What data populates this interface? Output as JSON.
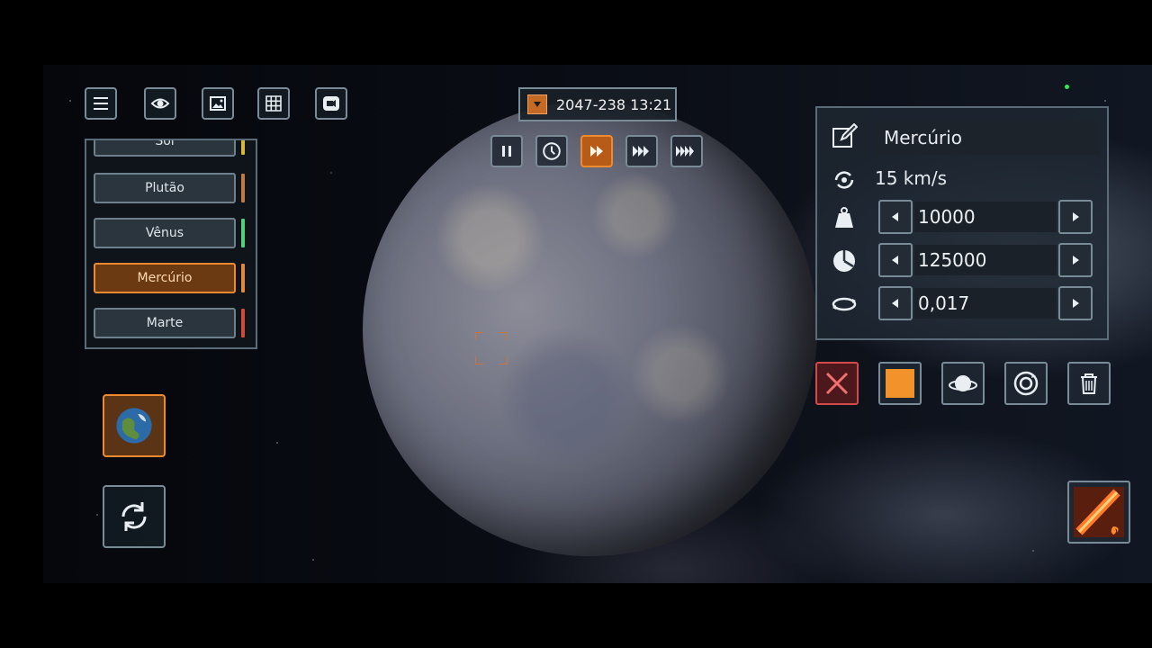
{
  "toolbar": {
    "icons": [
      "menu-icon",
      "eye-icon",
      "image-icon",
      "grid-icon",
      "camera-icon"
    ]
  },
  "body_list": {
    "items": [
      {
        "label": "Sol",
        "bar_color": "#d8b73a"
      },
      {
        "label": "Plutão",
        "bar_color": "#c07a45"
      },
      {
        "label": "Vênus",
        "bar_color": "#4ed27a"
      },
      {
        "label": "Mercúrio",
        "bar_color": "#e08a3a",
        "selected": true
      },
      {
        "label": "Marte",
        "bar_color": "#d04a3a"
      }
    ]
  },
  "time": {
    "date": "2047-238 13:21"
  },
  "speed_controls": [
    "pause-icon",
    "clock-icon",
    "fast-forward-icon",
    "faster-icon",
    "fastest-icon"
  ],
  "properties": {
    "name": "Mercúrio",
    "speed": "15 km/s",
    "mass": "10000",
    "diameter": "125000",
    "rotation": "0,017"
  },
  "colors": {
    "accent": "#f08a30",
    "panel_border": "#7a8b98",
    "delete": "#d24a4a"
  }
}
